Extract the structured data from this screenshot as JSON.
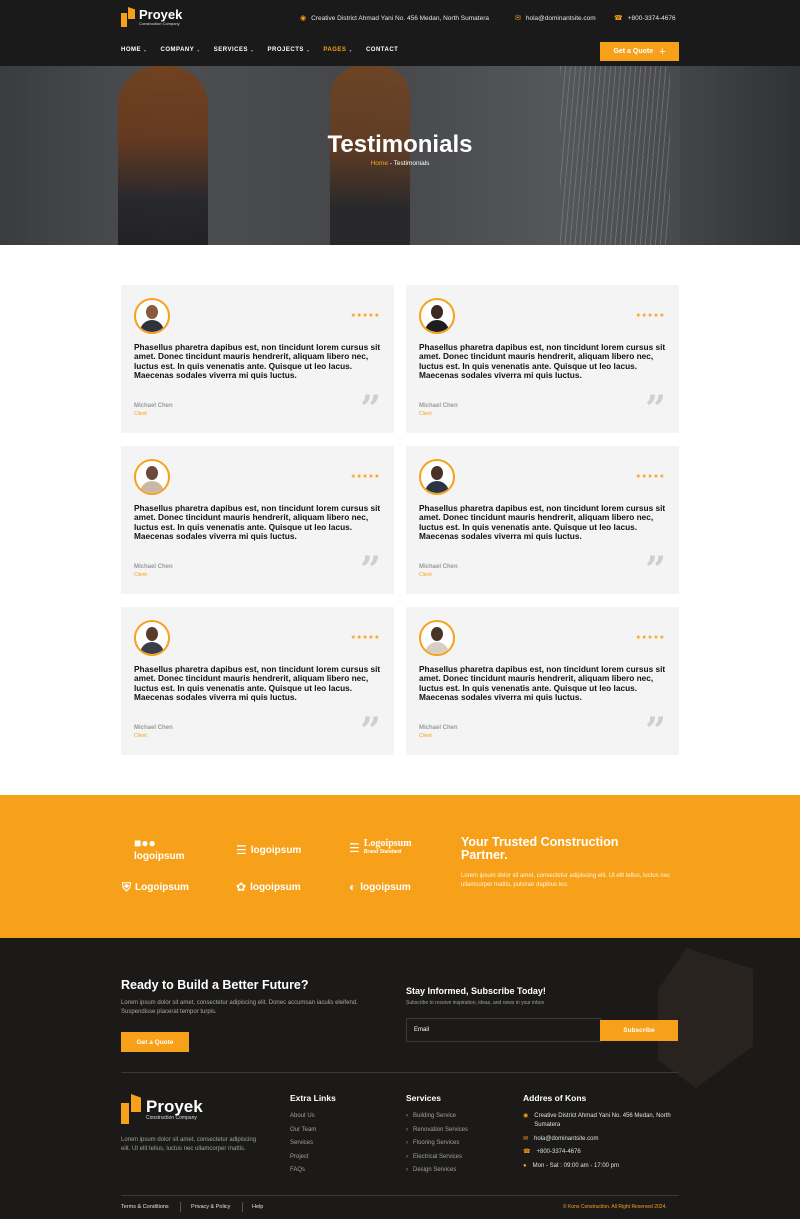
{
  "brand": {
    "name": "Proyek",
    "tagline": "Construction Company"
  },
  "topbar": {
    "address": "Creative District Ahmad Yani No. 456 Medan, North Sumatera",
    "email": "hola@dominantsite.com",
    "phone": "+800-3374-4676"
  },
  "nav": {
    "items": [
      "HOME",
      "COMPANY",
      "SERVICES",
      "PROJECTS",
      "PAGES",
      "CONTACT"
    ],
    "active": "PAGES",
    "quote_label": "Get a Quote"
  },
  "hero": {
    "title": "Testimonials",
    "breadcrumb_home": "Home",
    "breadcrumb_sep": " - ",
    "breadcrumb_current": "Testimonials"
  },
  "testimonials": [
    {
      "quote": "Phasellus pharetra dapibus est, non tincidunt lorem cursus sit amet. Donec tincidunt mauris hendrerit, aliquam libero nec, luctus est. In quis venenatis ante. Quisque ut leo lacus. Maecenas sodales viverra mi quis luctus.",
      "author": "Michael Chen",
      "role": "Client",
      "stars": "★★★★★"
    },
    {
      "quote": "Phasellus pharetra dapibus est, non tincidunt lorem cursus sit amet. Donec tincidunt mauris hendrerit, aliquam libero nec, luctus est. In quis venenatis ante. Quisque ut leo lacus. Maecenas sodales viverra mi quis luctus.",
      "author": "Michael Chen",
      "role": "Client",
      "stars": "★★★★★"
    },
    {
      "quote": "Phasellus pharetra dapibus est, non tincidunt lorem cursus sit amet. Donec tincidunt mauris hendrerit, aliquam libero nec, luctus est. In quis venenatis ante. Quisque ut leo lacus. Maecenas sodales viverra mi quis luctus.",
      "author": "Michael Chen",
      "role": "Client",
      "stars": "★★★★★"
    },
    {
      "quote": "Phasellus pharetra dapibus est, non tincidunt lorem cursus sit amet. Donec tincidunt mauris hendrerit, aliquam libero nec, luctus est. In quis venenatis ante. Quisque ut leo lacus. Maecenas sodales viverra mi quis luctus.",
      "author": "Michael Chen",
      "role": "Client",
      "stars": "★★★★★"
    },
    {
      "quote": "Phasellus pharetra dapibus est, non tincidunt lorem cursus sit amet. Donec tincidunt mauris hendrerit, aliquam libero nec, luctus est. In quis venenatis ante. Quisque ut leo lacus. Maecenas sodales viverra mi quis luctus.",
      "author": "Michael Chen",
      "role": "Client",
      "stars": "★★★★★"
    },
    {
      "quote": "Phasellus pharetra dapibus est, non tincidunt lorem cursus sit amet. Donec tincidunt mauris hendrerit, aliquam libero nec, luctus est. In quis venenatis ante. Quisque ut leo lacus. Maecenas sodales viverra mi quis luctus.",
      "author": "Michael Chen",
      "role": "Client",
      "stars": "★★★★★"
    }
  ],
  "partners": {
    "logos": [
      "logoipsum",
      "logoipsum",
      "Logoipsum",
      "Logoipsum",
      "logoipsum",
      "logoipsum"
    ],
    "logo3_sub": "Brand Standard",
    "title": "Your Trusted Construction Partner.",
    "text": "Lorem ipsum dolor sit amet, consectetur adipiscing elit. Ut elit tellus, luctus nec ullamcorper mattis, pulvinar dapibus leo."
  },
  "cta": {
    "title": "Ready to Build a Better Future?",
    "text": "Lorem ipsum dolor sit amet, consectetur adipiscing elit. Donec accumsan iaculis eleifend. Suspendisse placerat tempor turpis.",
    "button": "Get a Quote"
  },
  "subscribe": {
    "title": "Stay Informed, Subscribe Today!",
    "text": "Subscribe to receive inspiration, ideas, and news in your inbox",
    "placeholder": "Email",
    "button": "Subscribe"
  },
  "footer": {
    "about": "Lorem ipsum dolor sit amet, consectetur adipiscing elit. Ut elit tellus, luctus nec ullamcorper mattis.",
    "extra_title": "Extra Links",
    "extra_links": [
      "About Us",
      "Our Team",
      "Services",
      "Project",
      "FAQs"
    ],
    "services_title": "Services",
    "services": [
      "Building Service",
      "Renovation Services",
      "Flooring Services",
      "Electrical Services",
      "Design Services"
    ],
    "address_title": "Addres of Kons",
    "address": "Creative District Ahmad Yani No. 456 Medan, North Sumatera",
    "email": "hola@dominantsite.com",
    "phone": "+800-3374-4676",
    "hours": "Mon - Sat : 09:00 am - 17:00 pm",
    "legal": [
      "Terms & Conditions",
      "Privacy & Policy",
      "Help"
    ],
    "copyright": "© Kons Construction. All Right Reserved 2024."
  },
  "colors": {
    "accent": "#f7a11a",
    "dark": "#1a1a1a",
    "card": "#f4f4f4"
  }
}
